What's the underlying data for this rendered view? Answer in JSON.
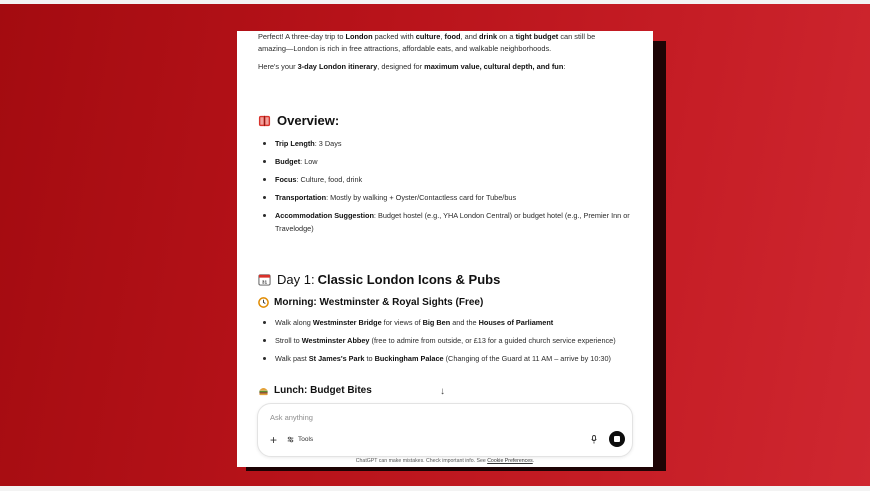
{
  "intro": {
    "line1_a": "Perfect! A three-day trip to ",
    "line1_b": "London",
    "line1_c": " packed with ",
    "line1_d": "culture",
    "line1_e": ", ",
    "line1_f": "food",
    "line1_g": ", and ",
    "line1_h": "drink",
    "line1_i": " on a ",
    "line1_j": "tight budget",
    "line1_k": " can still be",
    "line2": "amazing—London is rich in free attractions, affordable eats, and walkable neighborhoods.",
    "line3_a": "Here's your ",
    "line3_b": "3-day London itinerary",
    "line3_c": ", designed for ",
    "line3_d": "maximum value, cultural depth, and fun",
    "line3_e": ":"
  },
  "overview": {
    "icon": "book-icon",
    "title": "Overview:",
    "items": [
      {
        "label": "Trip Length",
        "value": ": 3 Days"
      },
      {
        "label": "Budget",
        "value": ": Low"
      },
      {
        "label": "Focus",
        "value": ": Culture, food, drink"
      },
      {
        "label": "Transportation",
        "value": ": Mostly by walking + Oyster/Contactless card for Tube/bus"
      },
      {
        "label": "Accommodation Suggestion",
        "value": ": Budget hostel (e.g., YHA London Central) or budget hotel (e.g., Premier Inn or Travelodge)"
      }
    ]
  },
  "day1": {
    "icon": "calendar-icon",
    "title_prefix": "Day 1: ",
    "title_bold": "Classic London Icons & Pubs",
    "morning": {
      "icon": "clock-icon",
      "title": "Morning: Westminster & Royal Sights (Free)"
    },
    "items": [
      {
        "p1": "Walk along ",
        "b1": "Westminster Bridge",
        "p2": " for views of ",
        "b2": "Big Ben",
        "p3": " and the ",
        "b3": "Houses of Parliament",
        "p4": ""
      },
      {
        "p1": "Stroll to ",
        "b1": "Westminster Abbey",
        "p2": " (free to admire from outside, or £13 for a guided church service experience)",
        "b2": "",
        "p3": "",
        "b3": "",
        "p4": ""
      },
      {
        "p1": "Walk past ",
        "b1": "St James's Park",
        "p2": " to ",
        "b2": "Buckingham Palace",
        "p3": " (Changing of the Guard at 11 AM – arrive by 10:30)",
        "b3": "",
        "p4": ""
      }
    ],
    "lunch": {
      "icon": "burger-icon",
      "title": "Lunch: Budget Bites"
    }
  },
  "scroll_down": "↓",
  "composer": {
    "placeholder": "Ask anything",
    "plus": "+",
    "tools_label": "Tools"
  },
  "disclaimer": {
    "text": "ChatGPT can make mistakes. Check important info. See ",
    "link": "Cookie Preferences",
    "end": "."
  }
}
